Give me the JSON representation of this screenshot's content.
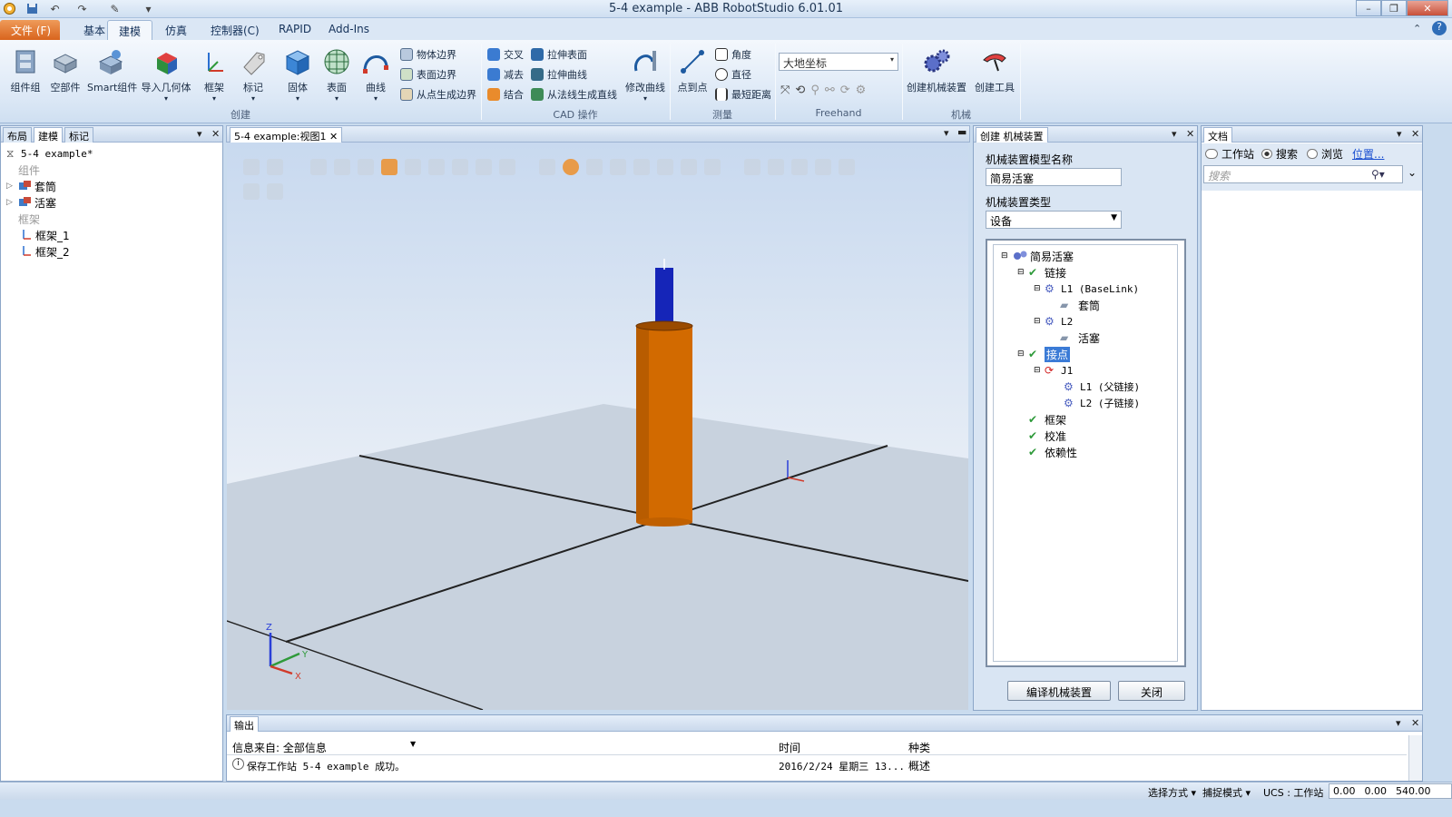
{
  "window": {
    "title": "5-4 example - ABB RobotStudio 6.01.01"
  },
  "menu_tabs": [
    "文件 (F)",
    "基本",
    "建模",
    "仿真",
    "控制器(C)",
    "RAPID",
    "Add-Ins"
  ],
  "ribbon": {
    "create": {
      "label": "创建",
      "buttons": [
        "组件组",
        "空部件",
        "Smart组件",
        "导入几何体",
        "框架",
        "标记",
        "固体",
        "表面",
        "曲线"
      ],
      "small": [
        "物体边界",
        "表面边界",
        "从点生成边界"
      ]
    },
    "cad": {
      "label": "CAD 操作",
      "small": [
        "交叉",
        "减去",
        "结合",
        "拉伸表面",
        "拉伸曲线",
        "从法线生成直线"
      ],
      "button": "修改曲线"
    },
    "measure": {
      "label": "测量",
      "button": "点到点",
      "small": [
        "角度",
        "直径",
        "最短距离"
      ]
    },
    "freehand": {
      "label": "Freehand",
      "frame_select": "大地坐标"
    },
    "mechanism": {
      "label": "机械",
      "buttons": [
        "创建机械装置",
        "创建工具"
      ]
    }
  },
  "left_panel": {
    "tabs": [
      "布局",
      "建模",
      "标记"
    ],
    "station": "5-4 example*",
    "section_components": "组件",
    "components": [
      "套筒",
      "活塞"
    ],
    "section_frames": "框架",
    "frames": [
      "框架_1",
      "框架_2"
    ]
  },
  "viewport": {
    "tab": "5-4 example:视图1",
    "axes": {
      "x": "X",
      "y": "Y",
      "z": "Z"
    }
  },
  "mechanism_panel": {
    "tab": "创建 机械装置",
    "name_label": "机械装置模型名称",
    "name_value": "简易活塞",
    "type_label": "机械装置类型",
    "type_value": "设备",
    "tree": {
      "root": "简易活塞",
      "links": "链接",
      "l1": "L1 (BaseLink)",
      "l1_part": "套筒",
      "l2": "L2",
      "l2_part": "活塞",
      "joints": "接点",
      "j1": "J1",
      "j1_parent": "L1 (父链接)",
      "j1_child": "L2 (子链接)",
      "frames": "框架",
      "calibration": "校准",
      "dependency": "依赖性"
    },
    "compile_button": "编译机械装置",
    "close_button": "关闭"
  },
  "docs_panel": {
    "tab": "文档",
    "radio": [
      "工作站",
      "搜索",
      "浏览"
    ],
    "selected_radio": "搜索",
    "location_link": "位置...",
    "search_placeholder": "搜索"
  },
  "output": {
    "tab": "输出",
    "filter_label": "信息来自: 全部信息",
    "col_time": "时间",
    "col_type": "种类",
    "rows": [
      {
        "message": "保存工作站 5-4 example 成功。",
        "time": "2016/2/24 星期三 13...",
        "type": "概述"
      }
    ]
  },
  "status": {
    "select_mode": "选择方式",
    "snap_mode": "捕捉模式",
    "ucs": "UCS : 工作站",
    "x": "0.00",
    "y": "0.00",
    "z": "540.00"
  }
}
